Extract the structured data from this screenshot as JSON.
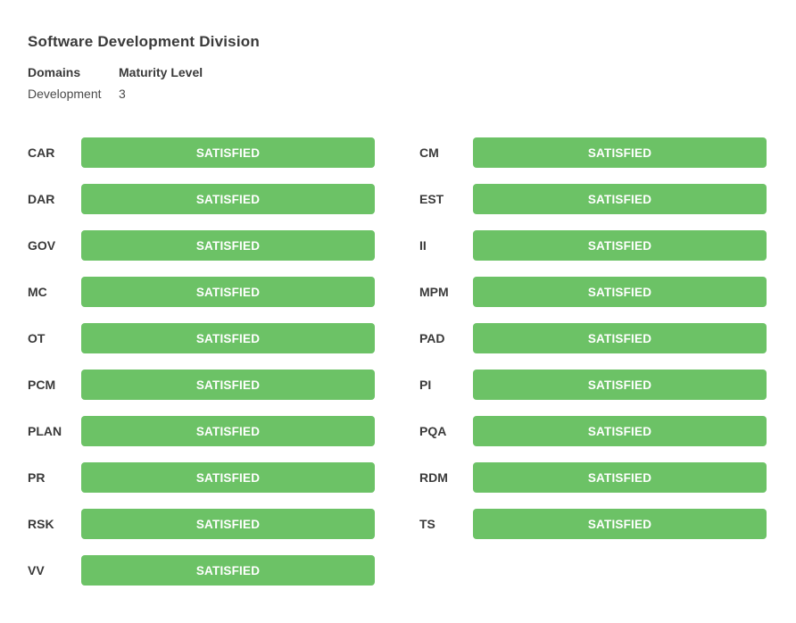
{
  "title": "Software Development Division",
  "meta": {
    "domains_header": "Domains",
    "maturity_header": "Maturity Level",
    "domain_value": "Development",
    "maturity_value": "3"
  },
  "status_color": "#6cc266",
  "practice_areas": [
    {
      "code": "CAR",
      "status": "SATISFIED"
    },
    {
      "code": "CM",
      "status": "SATISFIED"
    },
    {
      "code": "DAR",
      "status": "SATISFIED"
    },
    {
      "code": "EST",
      "status": "SATISFIED"
    },
    {
      "code": "GOV",
      "status": "SATISFIED"
    },
    {
      "code": "II",
      "status": "SATISFIED"
    },
    {
      "code": "MC",
      "status": "SATISFIED"
    },
    {
      "code": "MPM",
      "status": "SATISFIED"
    },
    {
      "code": "OT",
      "status": "SATISFIED"
    },
    {
      "code": "PAD",
      "status": "SATISFIED"
    },
    {
      "code": "PCM",
      "status": "SATISFIED"
    },
    {
      "code": "PI",
      "status": "SATISFIED"
    },
    {
      "code": "PLAN",
      "status": "SATISFIED"
    },
    {
      "code": "PQA",
      "status": "SATISFIED"
    },
    {
      "code": "PR",
      "status": "SATISFIED"
    },
    {
      "code": "RDM",
      "status": "SATISFIED"
    },
    {
      "code": "RSK",
      "status": "SATISFIED"
    },
    {
      "code": "TS",
      "status": "SATISFIED"
    },
    {
      "code": "VV",
      "status": "SATISFIED"
    }
  ]
}
